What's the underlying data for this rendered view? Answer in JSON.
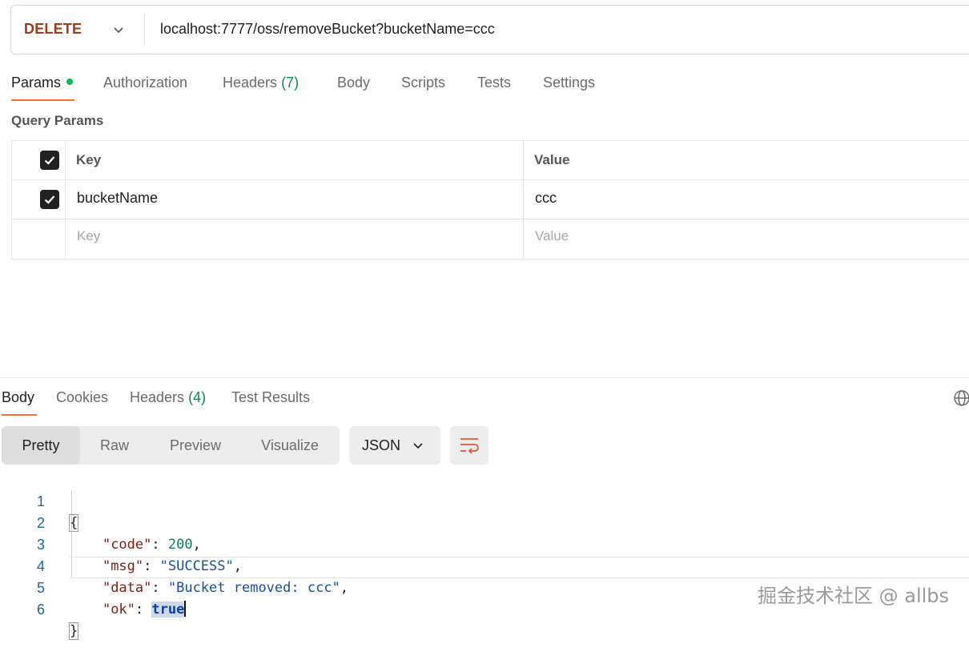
{
  "request": {
    "method": "DELETE",
    "url": "localhost:7777/oss/removeBucket?bucketName=ccc"
  },
  "request_tabs": [
    {
      "label": "Params",
      "count": ""
    },
    {
      "label": "Authorization",
      "count": ""
    },
    {
      "label": "Headers",
      "count": "(7)"
    },
    {
      "label": "Body",
      "count": ""
    },
    {
      "label": "Scripts",
      "count": ""
    },
    {
      "label": "Tests",
      "count": ""
    },
    {
      "label": "Settings",
      "count": ""
    }
  ],
  "query_params": {
    "title": "Query Params",
    "header_key": "Key",
    "header_value": "Value",
    "rows": [
      {
        "key": "bucketName",
        "value": "ccc",
        "checked": true
      }
    ],
    "placeholder_key": "Key",
    "placeholder_value": "Value"
  },
  "response_tabs": [
    {
      "label": "Body",
      "count": ""
    },
    {
      "label": "Cookies",
      "count": ""
    },
    {
      "label": "Headers",
      "count": "(4)"
    },
    {
      "label": "Test Results",
      "count": ""
    }
  ],
  "view_modes": [
    "Pretty",
    "Raw",
    "Preview",
    "Visualize"
  ],
  "format": "JSON",
  "response_body": {
    "line_numbers": [
      "1",
      "2",
      "3",
      "4",
      "5",
      "6"
    ],
    "open_brace": "{",
    "close_brace": "}",
    "code_key": "\"code\"",
    "code_value": "200",
    "msg_key": "\"msg\"",
    "msg_value": "\"SUCCESS\"",
    "data_key": "\"data\"",
    "data_value": "\"Bucket removed: ccc\"",
    "ok_key": "\"ok\"",
    "ok_value": "true"
  },
  "watermark": "掘金技术社区 @ allbs",
  "colors": {
    "accent": "#ff6c37",
    "method": "#a13b1b",
    "status_dot": "#0cbb52",
    "count": "#0c8b50"
  }
}
